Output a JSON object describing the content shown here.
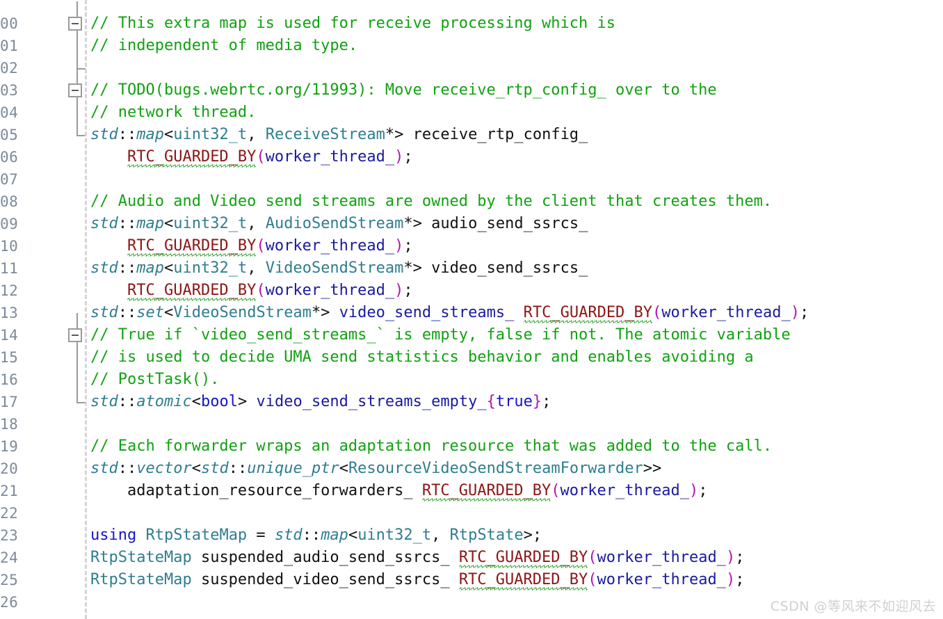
{
  "editor": {
    "language": "C++",
    "background_color": "#ffffff",
    "line_height_px": 32,
    "font_size_px": 22,
    "colors": {
      "comment": "#11a111",
      "type": "#2e7d8f",
      "keyword": "#1414d2",
      "macro": "#8c1616",
      "punctuation": "#b014b0",
      "member": "#1a1aa0",
      "plain": "#111111",
      "linenumber": "#7a8a9a",
      "squiggle": "#2e9b2e",
      "guide": "#d4d4d4",
      "fold": "#9a9a9a"
    }
  },
  "gutter": {
    "line_numbers": [
      "",
      "00",
      "01",
      "02",
      "03",
      "04",
      "05",
      "06",
      "07",
      "08",
      "09",
      "10",
      "11",
      "12",
      "13",
      "14",
      "15",
      "16",
      "17",
      "18",
      "19",
      "20",
      "21",
      "22",
      "23",
      "24",
      "25",
      "26"
    ],
    "fold_markers": [
      {
        "line_index": 1,
        "state": "expanded",
        "glyph": "minus-box"
      },
      {
        "line_index": 4,
        "state": "expanded",
        "glyph": "minus-box"
      },
      {
        "line_index": 15,
        "state": "expanded",
        "glyph": "minus-box"
      }
    ],
    "fold_regions": [
      {
        "start_line_index": 0,
        "end_line_index": 3
      },
      {
        "start_line_index": 3,
        "end_line_index": 6
      },
      {
        "start_line_index": 14,
        "end_line_index": 18
      }
    ]
  },
  "code": {
    "lines": [
      {
        "n": "",
        "tokens": []
      },
      {
        "n": "00",
        "tokens": [
          {
            "t": "comment",
            "s": "// This extra map is used for receive processing which is"
          }
        ]
      },
      {
        "n": "01",
        "tokens": [
          {
            "t": "comment",
            "s": "// independent of media type."
          }
        ]
      },
      {
        "n": "02",
        "tokens": []
      },
      {
        "n": "03",
        "tokens": [
          {
            "t": "comment",
            "s": "// TODO(bugs.webrtc.org/11993): Move receive_rtp_config_ over to the"
          }
        ]
      },
      {
        "n": "04",
        "tokens": [
          {
            "t": "comment",
            "s": "// network thread."
          }
        ]
      },
      {
        "n": "05",
        "tokens": [
          {
            "t": "type",
            "s": "std"
          },
          {
            "t": "plain",
            "s": "::"
          },
          {
            "t": "type",
            "s": "map"
          },
          {
            "t": "plain",
            "s": "<"
          },
          {
            "t": "typep",
            "s": "uint32_t"
          },
          {
            "t": "plain",
            "s": ", "
          },
          {
            "t": "typep",
            "s": "ReceiveStream"
          },
          {
            "t": "plain",
            "s": "*> receive_rtp_config_"
          }
        ]
      },
      {
        "n": "06",
        "tokens": [
          {
            "t": "plain",
            "s": "    "
          },
          {
            "t": "macro",
            "s": "RTC_GUARDED_BY",
            "squiggle": true
          },
          {
            "t": "punct",
            "s": "("
          },
          {
            "t": "member",
            "s": "worker_thread_"
          },
          {
            "t": "punct",
            "s": ")"
          },
          {
            "t": "plain",
            "s": ";"
          }
        ]
      },
      {
        "n": "07",
        "tokens": []
      },
      {
        "n": "08",
        "tokens": [
          {
            "t": "comment",
            "s": "// Audio and Video send streams are owned by the client that creates them."
          }
        ]
      },
      {
        "n": "09",
        "tokens": [
          {
            "t": "type",
            "s": "std"
          },
          {
            "t": "plain",
            "s": "::"
          },
          {
            "t": "type",
            "s": "map"
          },
          {
            "t": "plain",
            "s": "<"
          },
          {
            "t": "typep",
            "s": "uint32_t"
          },
          {
            "t": "plain",
            "s": ", "
          },
          {
            "t": "typep",
            "s": "AudioSendStream"
          },
          {
            "t": "plain",
            "s": "*> audio_send_ssrcs_"
          }
        ]
      },
      {
        "n": "10",
        "tokens": [
          {
            "t": "plain",
            "s": "    "
          },
          {
            "t": "macro",
            "s": "RTC_GUARDED_BY",
            "squiggle": true
          },
          {
            "t": "punct",
            "s": "("
          },
          {
            "t": "member",
            "s": "worker_thread_"
          },
          {
            "t": "punct",
            "s": ")"
          },
          {
            "t": "plain",
            "s": ";"
          }
        ]
      },
      {
        "n": "11",
        "tokens": [
          {
            "t": "type",
            "s": "std"
          },
          {
            "t": "plain",
            "s": "::"
          },
          {
            "t": "type",
            "s": "map"
          },
          {
            "t": "plain",
            "s": "<"
          },
          {
            "t": "typep",
            "s": "uint32_t"
          },
          {
            "t": "plain",
            "s": ", "
          },
          {
            "t": "typep",
            "s": "VideoSendStream"
          },
          {
            "t": "plain",
            "s": "*> video_send_ssrcs_"
          }
        ]
      },
      {
        "n": "12",
        "tokens": [
          {
            "t": "plain",
            "s": "    "
          },
          {
            "t": "macro",
            "s": "RTC_GUARDED_BY",
            "squiggle": true
          },
          {
            "t": "punct",
            "s": "("
          },
          {
            "t": "member",
            "s": "worker_thread_"
          },
          {
            "t": "punct",
            "s": ")"
          },
          {
            "t": "plain",
            "s": ";"
          }
        ]
      },
      {
        "n": "13",
        "tokens": [
          {
            "t": "type",
            "s": "std"
          },
          {
            "t": "plain",
            "s": "::"
          },
          {
            "t": "type",
            "s": "set"
          },
          {
            "t": "plain",
            "s": "<"
          },
          {
            "t": "typep",
            "s": "VideoSendStream"
          },
          {
            "t": "plain",
            "s": "*> "
          },
          {
            "t": "member",
            "s": "video_send_streams_"
          },
          {
            "t": "plain",
            "s": " "
          },
          {
            "t": "macro",
            "s": "RTC_GUARDED_BY",
            "squiggle": true
          },
          {
            "t": "punct",
            "s": "("
          },
          {
            "t": "member",
            "s": "worker_thread_"
          },
          {
            "t": "punct",
            "s": ")"
          },
          {
            "t": "plain",
            "s": ";"
          }
        ]
      },
      {
        "n": "14",
        "tokens": [
          {
            "t": "comment",
            "s": "// True if `video_send_streams_` is empty, false if not. The atomic variable"
          }
        ]
      },
      {
        "n": "15",
        "tokens": [
          {
            "t": "comment",
            "s": "// is used to decide UMA send statistics behavior and enables avoiding a"
          }
        ]
      },
      {
        "n": "16",
        "tokens": [
          {
            "t": "comment",
            "s": "// PostTask()."
          }
        ]
      },
      {
        "n": "17",
        "tokens": [
          {
            "t": "type",
            "s": "std"
          },
          {
            "t": "plain",
            "s": "::"
          },
          {
            "t": "type",
            "s": "atomic"
          },
          {
            "t": "plain",
            "s": "<"
          },
          {
            "t": "keyword",
            "s": "bool"
          },
          {
            "t": "plain",
            "s": "> "
          },
          {
            "t": "member",
            "s": "video_send_streams_empty_"
          },
          {
            "t": "punct",
            "s": "{"
          },
          {
            "t": "keyword",
            "s": "true"
          },
          {
            "t": "punct",
            "s": "}"
          },
          {
            "t": "plain",
            "s": ";"
          }
        ]
      },
      {
        "n": "18",
        "tokens": []
      },
      {
        "n": "19",
        "tokens": [
          {
            "t": "comment",
            "s": "// Each forwarder wraps an adaptation resource that was added to the call."
          }
        ]
      },
      {
        "n": "20",
        "tokens": [
          {
            "t": "type",
            "s": "std"
          },
          {
            "t": "plain",
            "s": "::"
          },
          {
            "t": "type",
            "s": "vector"
          },
          {
            "t": "plain",
            "s": "<"
          },
          {
            "t": "type",
            "s": "std"
          },
          {
            "t": "plain",
            "s": "::"
          },
          {
            "t": "type",
            "s": "unique_ptr"
          },
          {
            "t": "plain",
            "s": "<"
          },
          {
            "t": "typep",
            "s": "ResourceVideoSendStreamForwarder"
          },
          {
            "t": "plain",
            "s": ">>"
          }
        ]
      },
      {
        "n": "21",
        "tokens": [
          {
            "t": "plain",
            "s": "    adaptation_resource_forwarders_ "
          },
          {
            "t": "macro",
            "s": "RTC_GUARDED_BY",
            "squiggle": true
          },
          {
            "t": "punct",
            "s": "("
          },
          {
            "t": "member",
            "s": "worker_thread_"
          },
          {
            "t": "punct",
            "s": ")"
          },
          {
            "t": "plain",
            "s": ";"
          }
        ]
      },
      {
        "n": "22",
        "tokens": []
      },
      {
        "n": "23",
        "tokens": [
          {
            "t": "keyword",
            "s": "using"
          },
          {
            "t": "plain",
            "s": " "
          },
          {
            "t": "typep",
            "s": "RtpStateMap"
          },
          {
            "t": "plain",
            "s": " = "
          },
          {
            "t": "type",
            "s": "std"
          },
          {
            "t": "plain",
            "s": "::"
          },
          {
            "t": "type",
            "s": "map"
          },
          {
            "t": "plain",
            "s": "<"
          },
          {
            "t": "typep",
            "s": "uint32_t"
          },
          {
            "t": "plain",
            "s": ", "
          },
          {
            "t": "typep",
            "s": "RtpState"
          },
          {
            "t": "plain",
            "s": ">;"
          }
        ]
      },
      {
        "n": "24",
        "tokens": [
          {
            "t": "typep",
            "s": "RtpStateMap"
          },
          {
            "t": "plain",
            "s": " suspended_audio_send_ssrcs_ "
          },
          {
            "t": "macro",
            "s": "RTC_GUARDED_BY",
            "squiggle": true
          },
          {
            "t": "punct",
            "s": "("
          },
          {
            "t": "member",
            "s": "worker_thread_"
          },
          {
            "t": "punct",
            "s": ")"
          },
          {
            "t": "plain",
            "s": ";"
          }
        ]
      },
      {
        "n": "25",
        "tokens": [
          {
            "t": "typep",
            "s": "RtpStateMap"
          },
          {
            "t": "plain",
            "s": " suspended_video_send_ssrcs_ "
          },
          {
            "t": "macro",
            "s": "RTC_GUARDED_BY",
            "squiggle": true
          },
          {
            "t": "punct",
            "s": "("
          },
          {
            "t": "member",
            "s": "worker_thread_"
          },
          {
            "t": "punct",
            "s": ")"
          },
          {
            "t": "plain",
            "s": ";"
          }
        ]
      },
      {
        "n": "26",
        "tokens": []
      }
    ]
  },
  "watermark": {
    "text": "CSDN @等风来不如迎风去"
  }
}
